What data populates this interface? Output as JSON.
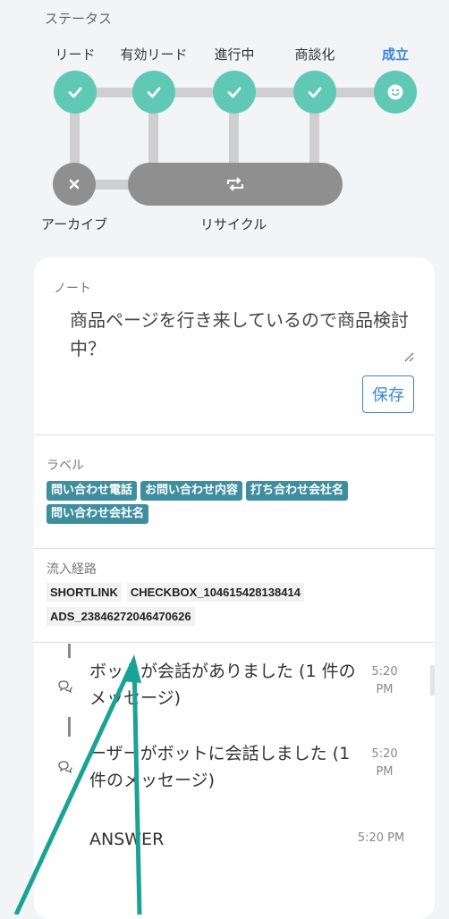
{
  "status": {
    "title": "ステータス",
    "stages": [
      {
        "label": "リード",
        "state": "done"
      },
      {
        "label": "有効リード",
        "state": "done"
      },
      {
        "label": "進行中",
        "state": "done"
      },
      {
        "label": "商談化",
        "state": "done"
      },
      {
        "label": "成立",
        "state": "current"
      }
    ],
    "archive_label": "アーカイブ",
    "recycle_label": "リサイクル",
    "colors": {
      "done": "#5fc9b6",
      "inactive": "#8f8f8f",
      "connector": "#cfcfcf",
      "current_label": "#3a86d6"
    }
  },
  "note": {
    "label": "ノート",
    "text": "商品ページを行き来しているので商品検討中？",
    "save_label": "保存"
  },
  "labels": {
    "title": "ラベル",
    "tags": [
      "問い合わせ電話",
      "お問い合わせ内容",
      "打ち合わせ会社名",
      "問い合わせ会社名"
    ],
    "tag_color": "#3f8ea0"
  },
  "inflow": {
    "title": "流入経路",
    "items": [
      "SHORTLINK",
      "CHECKBOX_104615428138414",
      "ADS_23846272046470626"
    ]
  },
  "timeline": [
    {
      "text": "ボットが会話がありました (1 件のメッセージ)",
      "time": "5:20 PM",
      "icon": "chat-bubble-icon"
    },
    {
      "text": "ーザーがボットに会話しました (1 件のメッセージ)",
      "time": "5:20 PM",
      "icon": "chat-bubble-icon"
    },
    {
      "text": "ANSWER",
      "time": "5:20 PM",
      "icon": "none"
    }
  ]
}
